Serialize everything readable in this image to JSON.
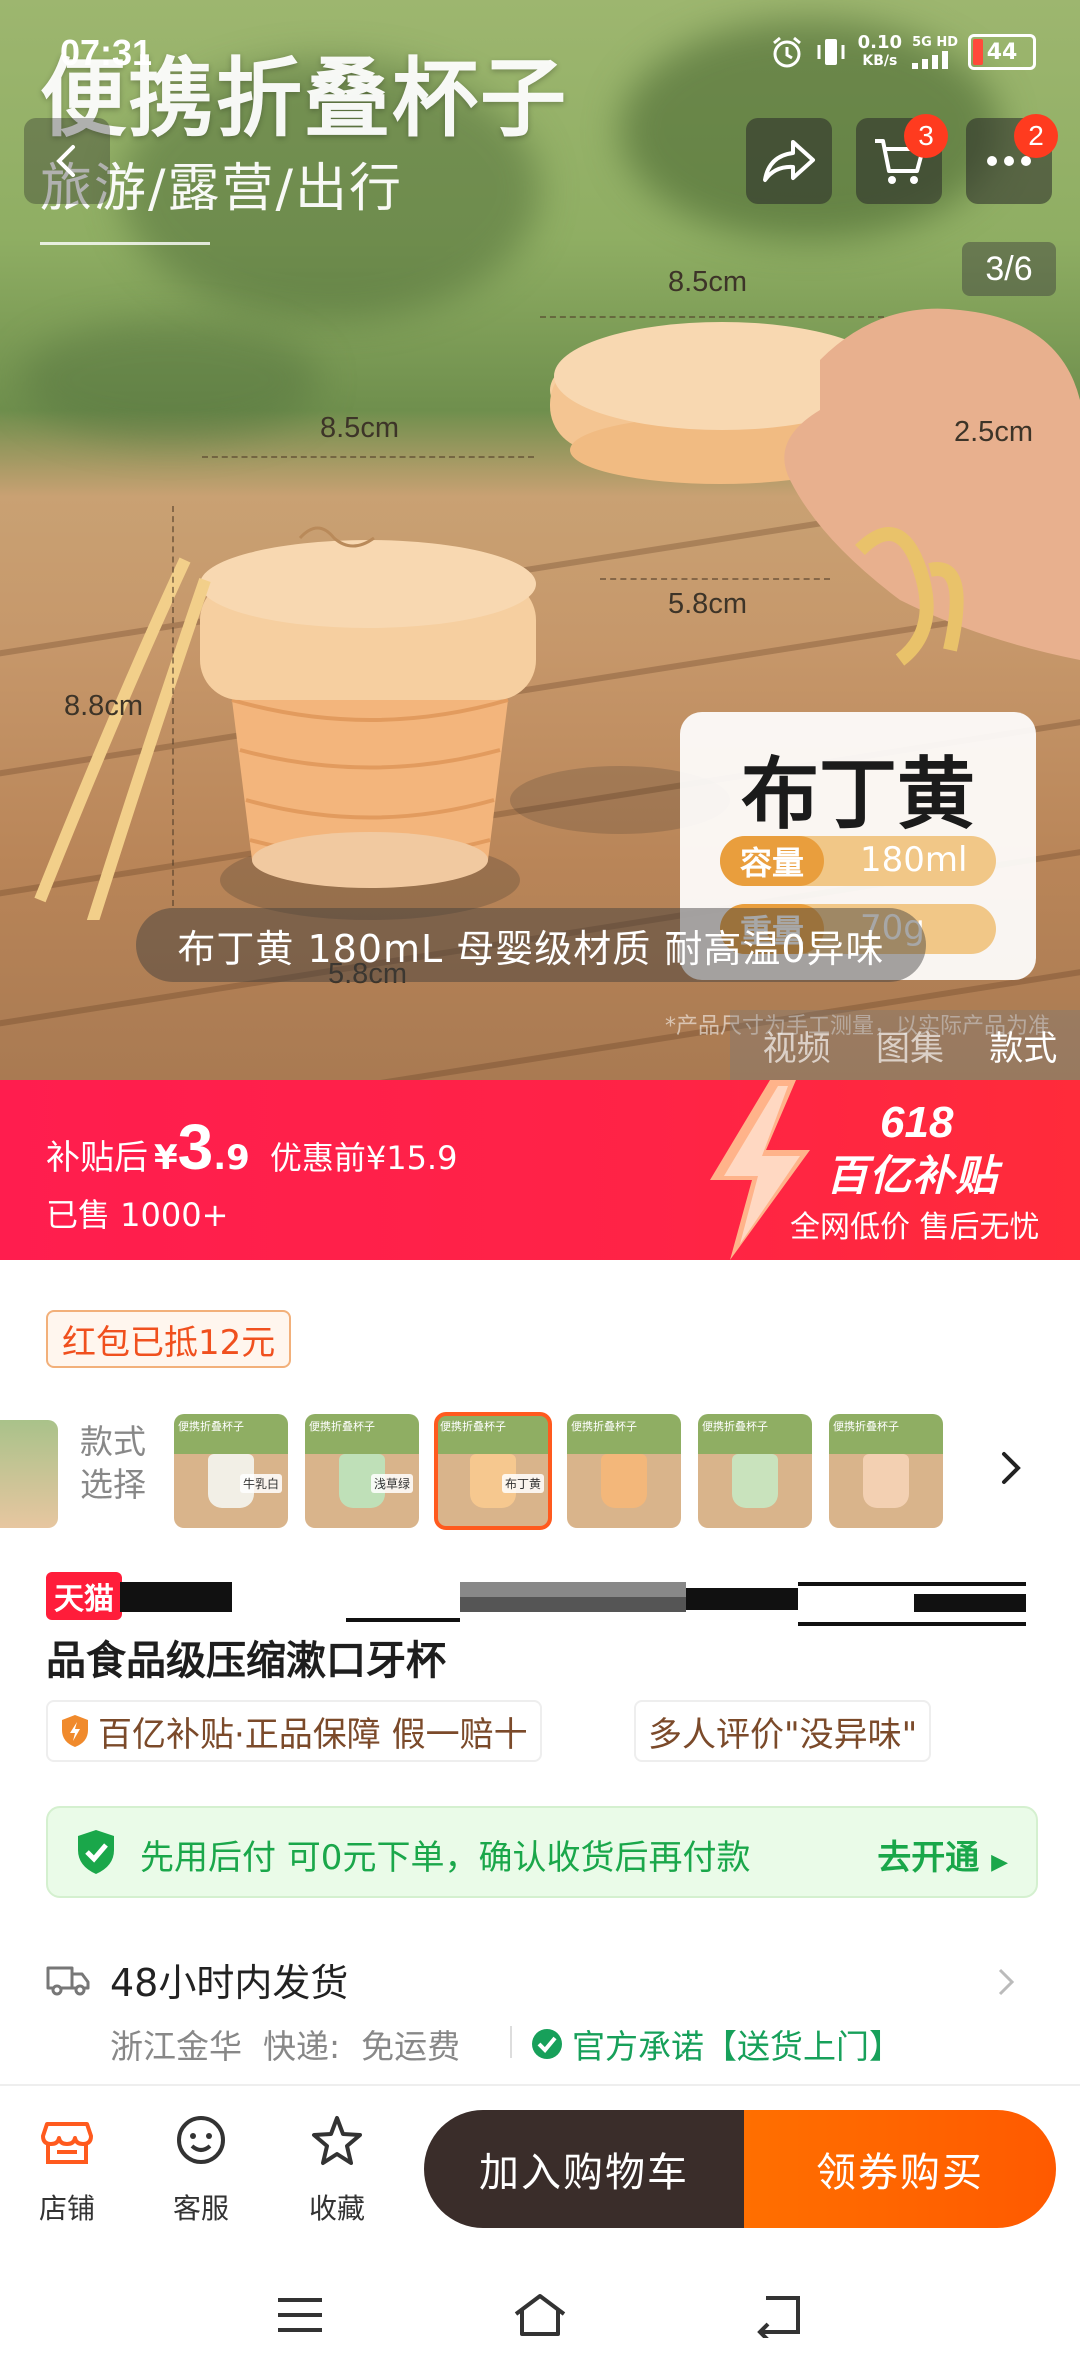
{
  "status_bar": {
    "time": "07:31",
    "net_speed": "0.10",
    "net_unit": "KB/s",
    "network": "5G HD",
    "battery": "44"
  },
  "hero": {
    "title": "便携折叠杯子",
    "subtitle": "旅游/露营/出行",
    "page_indicator": "3/6",
    "cart_badge": "3",
    "more_badge": "2",
    "dimensions": {
      "top_width_right": "8.5cm",
      "top_width_left": "8.5cm",
      "height_folded": "2.5cm",
      "bottom_right": "5.8cm",
      "height_left": "8.8cm",
      "bottom_left": "5.8cm"
    },
    "color_card": {
      "name": "布丁黄",
      "capacity_label": "容量",
      "capacity_value": "180ml",
      "weight_label": "重量",
      "weight_value": "70g"
    },
    "caption": "布丁黄 180mL 母婴级材质  耐高温0异味",
    "note": "*产品尺寸为手工测量，以实际产品为准",
    "media_tabs": [
      "视频",
      "图集",
      "款式"
    ],
    "active_media_tab": "款式"
  },
  "price_banner": {
    "label": "补贴后",
    "currency": "¥",
    "price_int": "3",
    "price_dec": ".9",
    "original": "优惠前¥15.9",
    "sold": "已售 1000+",
    "event": "618",
    "event_name": "百亿补贴",
    "slogan": "全网低价 售后无忧"
  },
  "red_packet": "红包已抵12元",
  "variants": {
    "label_line1": "款式",
    "label_line2": "选择",
    "items": [
      {
        "title": "便携折叠杯子",
        "caption": "牛乳白",
        "color": "#f2efe6"
      },
      {
        "title": "便携折叠杯子",
        "caption": "浅草绿",
        "color": "#bfe0b8"
      },
      {
        "title": "便携折叠杯子",
        "caption": "布丁黄",
        "color": "#f6c88f"
      },
      {
        "title": "便携折叠杯子",
        "caption": "",
        "color": "#f3b77a"
      },
      {
        "title": "便携折叠杯子",
        "caption": "",
        "color": "#c9e3bd"
      },
      {
        "title": "便携折叠杯子",
        "caption": "",
        "color": "#f3d0b2"
      }
    ],
    "selected_index": 2
  },
  "product": {
    "store_tag": "天猫",
    "title_line2": "品食品级压缩漱口牙杯"
  },
  "tags": {
    "subsidy": "百亿补贴·正品保障 假一赔十",
    "review": "多人评价\"没异味\""
  },
  "pay_later": {
    "text": "先用后付 可0元下单，确认收货后再付款",
    "cta": "去开通"
  },
  "shipping": {
    "title": "48小时内发货",
    "origin": "浙江金华",
    "courier_label": "快递:",
    "courier_value": "免运费",
    "promise": "官方承诺【送货上门】"
  },
  "bottom_bar": {
    "store": "店铺",
    "service": "客服",
    "favorite": "收藏",
    "add_cart": "加入购物车",
    "buy": "领券购买"
  },
  "colors": {
    "brand_red": "#ff1d4e",
    "buy_orange": "#ff6200",
    "cart_dark": "#3a2d2a",
    "green": "#1aa74a"
  }
}
